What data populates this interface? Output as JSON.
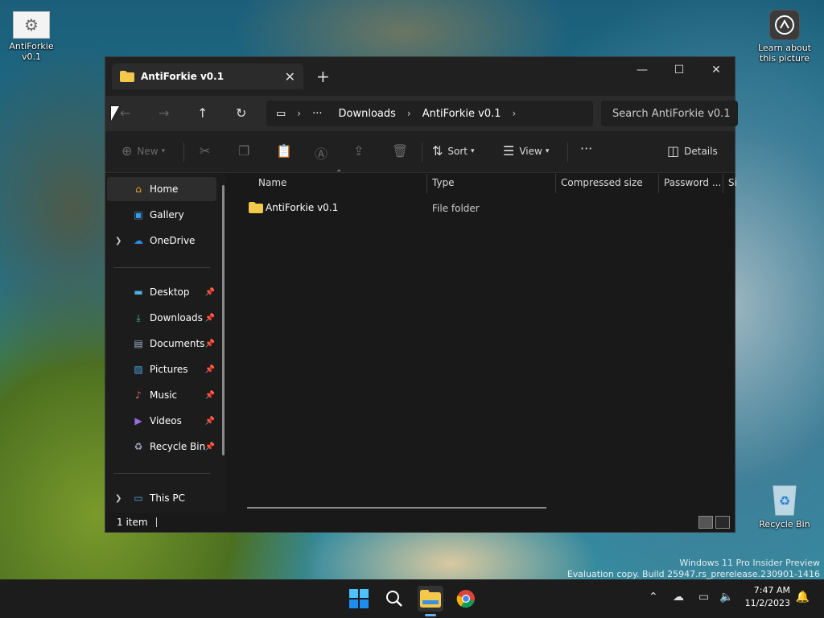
{
  "desktop": {
    "icons": [
      {
        "label": "AntiForkie v0.1"
      },
      {
        "label": "Learn about this picture"
      },
      {
        "label": "Recycle Bin"
      }
    ],
    "watermark": {
      "line1": "Windows 11 Pro Insider Preview",
      "line2": "Evaluation copy. Build 25947.rs_prerelease.230901-1416"
    }
  },
  "window": {
    "tab_title": "AntiForkie v0.1",
    "close_tab": "✕",
    "new_tab": "+",
    "controls": {
      "minimize": "—",
      "maximize": "☐",
      "close": "✕"
    },
    "nav": {
      "back": "←",
      "forward": "→",
      "up": "↑",
      "refresh": "↻"
    },
    "breadcrumb": {
      "more": "···",
      "items": [
        "Downloads",
        "AntiForkie v0.1"
      ]
    },
    "search_placeholder": "Search AntiForkie v0.1",
    "commands": {
      "new": "New",
      "sort": "Sort",
      "view": "View",
      "more": "···",
      "details": "Details"
    },
    "sidebar": {
      "home": "Home",
      "gallery": "Gallery",
      "onedrive": "OneDrive",
      "desktop": "Desktop",
      "downloads": "Downloads",
      "documents": "Documents",
      "pictures": "Pictures",
      "music": "Music",
      "videos": "Videos",
      "recycle_bin": "Recycle Bin",
      "this_pc": "This PC"
    },
    "columns": {
      "name": "Name",
      "type": "Type",
      "compressed_size": "Compressed size",
      "password": "Password ...",
      "size": "Si"
    },
    "rows": [
      {
        "name": "AntiForkie v0.1",
        "type": "File folder"
      }
    ],
    "status": "1 item"
  },
  "taskbar": {
    "time": "7:47 AM",
    "date": "11/2/2023"
  },
  "colors": {
    "accent": "#4aa3f0",
    "folder": "#f4c84a"
  }
}
